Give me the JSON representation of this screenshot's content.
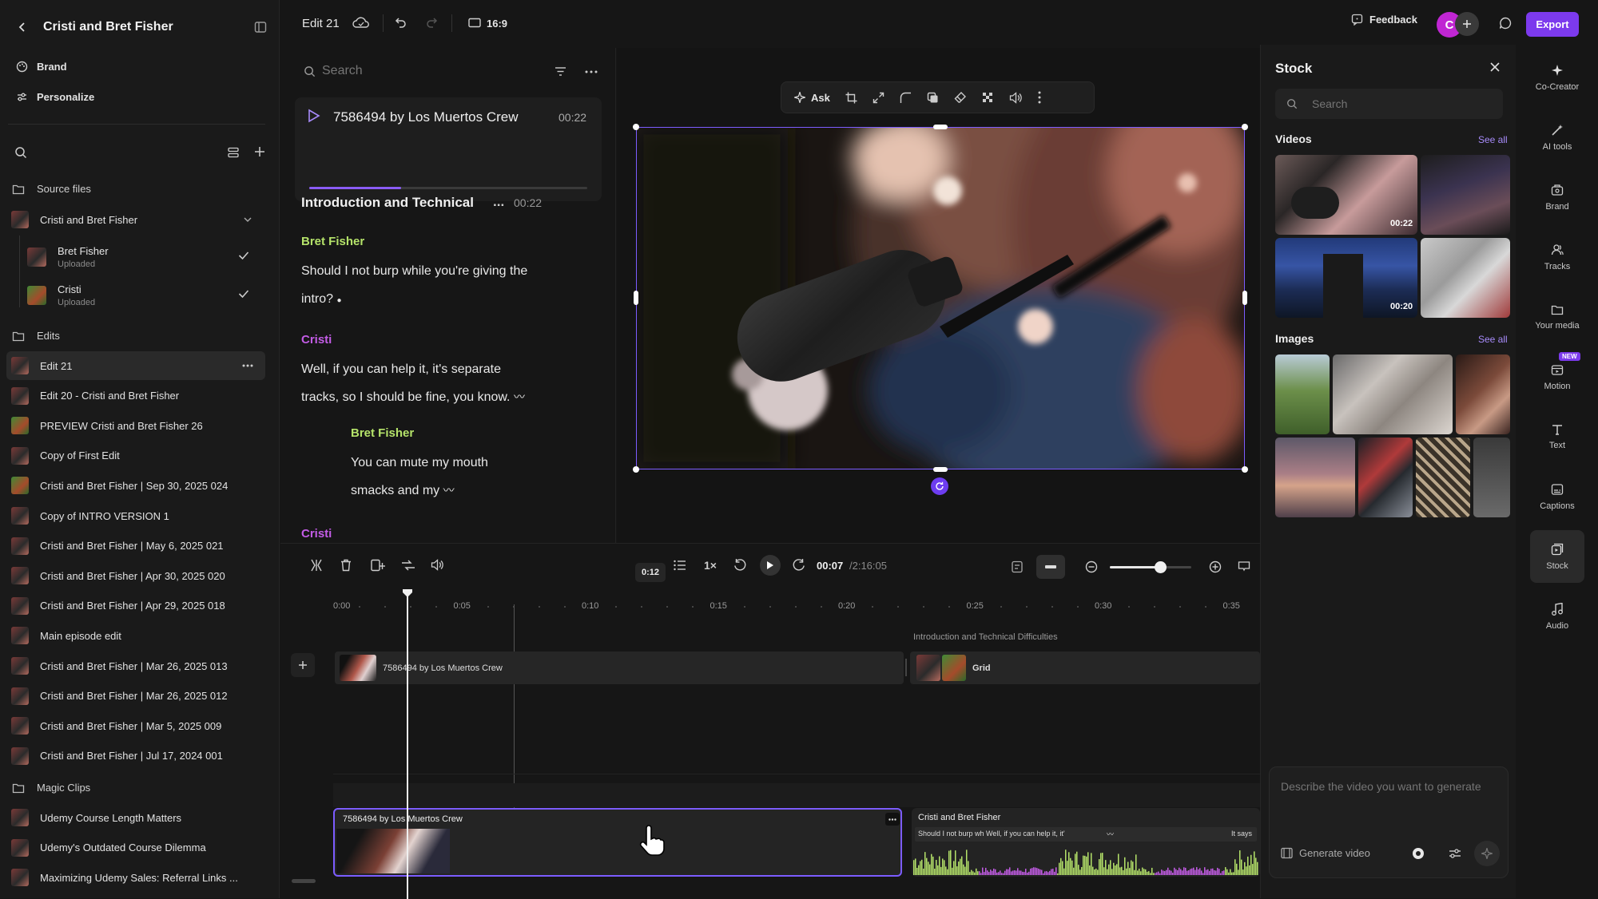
{
  "sidebar": {
    "title": "Cristi and Bret Fisher",
    "links": [
      "Brand",
      "Personalize"
    ],
    "source_files_label": "Source files",
    "source_group": "Cristi and Bret Fisher",
    "source_items": [
      {
        "name": "Bret Fisher",
        "status": "Uploaded"
      },
      {
        "name": "Cristi",
        "status": "Uploaded"
      }
    ],
    "edits_label": "Edits",
    "edits": [
      "Edit 21",
      "Edit 20 - Cristi and Bret Fisher",
      "PREVIEW Cristi and Bret Fisher 26",
      "Copy of First Edit",
      "Cristi and Bret Fisher | Sep 30, 2025 024",
      "Copy of INTRO VERSION 1",
      "Cristi and Bret Fisher | May 6, 2025 021",
      "Cristi and Bret Fisher | Apr 30, 2025 020",
      "Cristi and Bret Fisher | Apr 29, 2025 018",
      "Main episode edit",
      "Cristi and Bret Fisher | Mar 26, 2025 013",
      "Cristi and Bret Fisher | Mar 26, 2025 012",
      "Cristi and Bret Fisher | Mar 5, 2025 009",
      "Cristi and Bret Fisher | Jul 17, 2024 001"
    ],
    "magic_clips_label": "Magic Clips",
    "magic_clips": [
      "Udemy Course Length Matters",
      "Udemy's Outdated Course Dilemma",
      "Maximizing Udemy Sales: Referral Links ..."
    ]
  },
  "topbar": {
    "edit_name": "Edit 21",
    "aspect": "16:9",
    "feedback": "Feedback",
    "avatar_letter": "C",
    "export": "Export"
  },
  "transcript": {
    "search_placeholder": "Search",
    "clip_title": "7586494 by Los Muertos Crew",
    "clip_time": "00:22",
    "clip_progress": 0.33,
    "section_title": "Introduction and Technical",
    "section_ellipsis": "...",
    "section_time": "00:22",
    "blocks": [
      {
        "speaker": "Bret Fisher",
        "lines": [
          "Should I not burp while you're giving the",
          "intro?"
        ]
      },
      {
        "speaker": "Cristi",
        "lines": [
          "Well, if you can help it, it's separate",
          "tracks, so I should be fine, you know."
        ]
      },
      {
        "speaker": "Bret Fisher",
        "lines": [
          "You can mute my mouth",
          "smacks and my"
        ]
      },
      {
        "speaker": "Cristi",
        "lines": []
      }
    ]
  },
  "preview": {
    "ask_label": "Ask"
  },
  "timeline": {
    "hover_time": "0:12",
    "speed": "1×",
    "current_time": "00:07",
    "total_time": "/2:16:05",
    "zoom_level": 0.62,
    "ticks": [
      "0:00",
      "0:05",
      "0:10",
      "0:15",
      "0:20",
      "0:25",
      "0:30",
      "0:35"
    ],
    "section_label": "Introduction and Technical Difficulties",
    "scene_track": [
      {
        "label": "7586494 by Los Muertos Crew"
      },
      {
        "label": "Grid"
      }
    ],
    "media_clip": {
      "label": "7586494 by Los Muertos Crew"
    },
    "audio_clip": {
      "label": "Cristi and Bret Fisher",
      "caption": "Should I not burp wh Well, if you can help it, it'",
      "caption2": "It says"
    }
  },
  "stock": {
    "title": "Stock",
    "search_placeholder": "Search",
    "videos_label": "Videos",
    "see_all": "See all",
    "videos": [
      {
        "duration": "00:22"
      },
      {
        "duration": ""
      },
      {
        "duration": "00:20"
      },
      {
        "duration": ""
      }
    ],
    "images_label": "Images",
    "generate_placeholder": "Describe the video you want to generate",
    "generate_label": "Generate video"
  },
  "rail": {
    "items": [
      "Co-Creator",
      "AI tools",
      "Brand",
      "Tracks",
      "Your media",
      "Motion",
      "Text",
      "Captions",
      "Stock",
      "Audio"
    ],
    "new_badge": "NEW"
  },
  "colors": {
    "accent": "#7c3aed",
    "bret": "#b5e36a",
    "cristi": "#c35ce6",
    "export_bg": "#7c3aed"
  }
}
